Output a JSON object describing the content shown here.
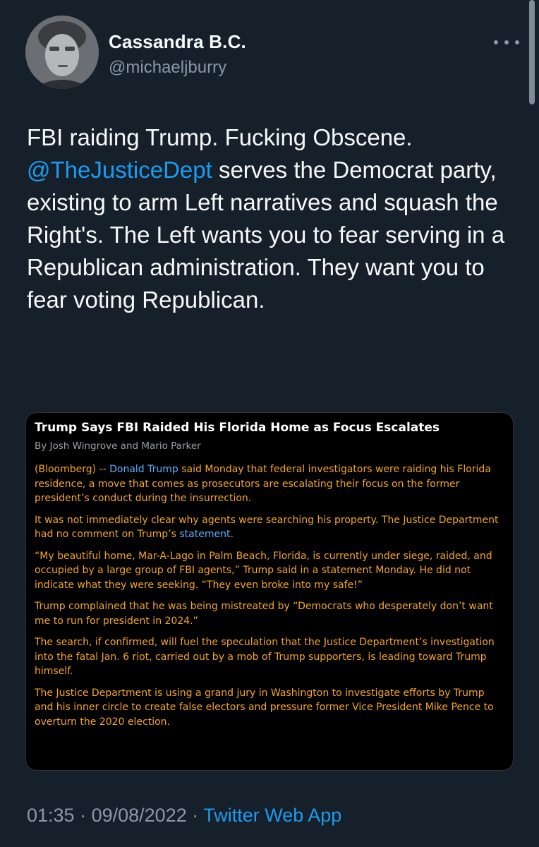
{
  "user": {
    "name": "Cassandra B.C.",
    "handle": "@michaeljburry"
  },
  "tweet": {
    "text_before": "FBI raiding Trump. Fucking Obscene.",
    "mention": "@TheJusticeDept",
    "text_after": " serves the Democrat party, existing to arm Left narratives and squash the Right's. The Left wants you to fear serving in a Republican administration. They want you to fear voting Republican."
  },
  "article": {
    "title": "Trump Says FBI Raided His Florida Home as Focus Escalates",
    "byline": "By Josh Wingrove and Mario Parker",
    "p1_prefix": "(Bloomberg) -- ",
    "p1_link": "Donald Trump",
    "p1_rest": " said Monday that federal investigators were raiding his Florida residence, a move that comes as prosecutors are escalating their focus on the former president’s conduct during the insurrection.",
    "p2_text": "It was not immediately clear why agents were searching his property. The Justice Department had no comment on Trump’s ",
    "p2_link": "statement",
    "p2_end": ".",
    "p3": "“My beautiful home, Mar-A-Lago in Palm Beach, Florida, is currently under siege, raided, and occupied by a large group of FBI agents,” Trump said in a statement Monday. He did not indicate what they were seeking. “They even broke into my safe!”",
    "p4": "Trump complained that he was being mistreated by “Democrats who desperately don’t want me to run for president in 2024.”",
    "p5": "The search, if confirmed, will fuel the speculation that the Justice Department’s investigation into the fatal Jan. 6 riot, carried out by a mob of Trump supporters, is leading toward Trump himself.",
    "p6": "The Justice Department is using a grand jury in Washington to investigate efforts by Trump and his inner circle to create false electors and pressure former Vice President Mike Pence to overturn the 2020 election."
  },
  "meta": {
    "time": "01:35",
    "sep1": " · ",
    "date": "09/08/2022",
    "sep2": " · ",
    "app": "Twitter Web App"
  },
  "icons": {
    "more": "more-dots-icon",
    "avatar": "avatar"
  },
  "colors": {
    "background": "#15202b",
    "link": "#1d9bf0",
    "muted": "#8b98a5",
    "article_text": "#f5a623"
  }
}
